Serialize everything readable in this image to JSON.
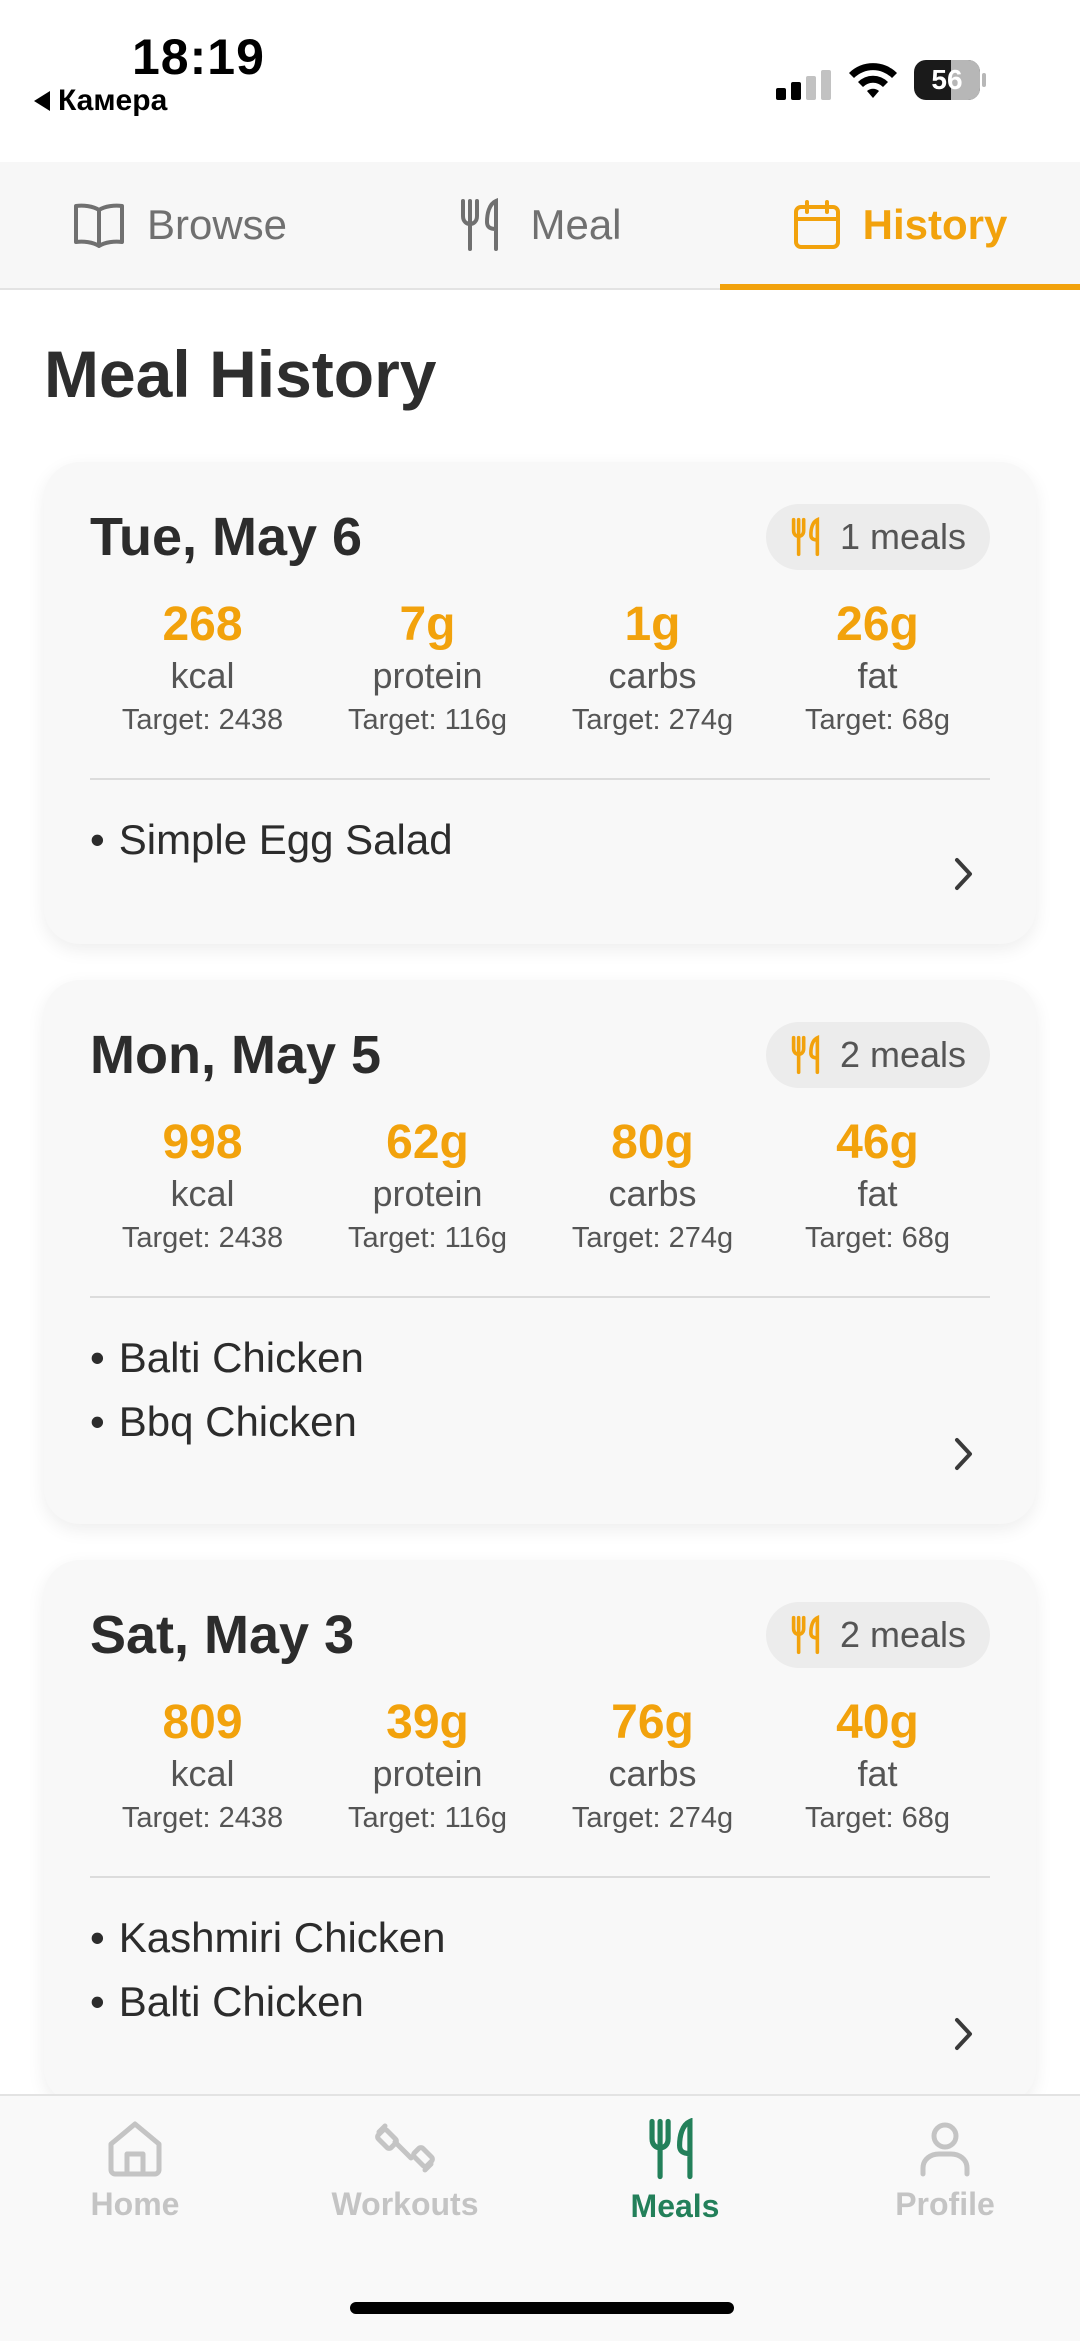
{
  "status_bar": {
    "time": "18:19",
    "back_label": "Камера",
    "battery": "56"
  },
  "top_tabs": [
    {
      "label": "Browse",
      "icon": "book-icon",
      "active": false
    },
    {
      "label": "Meal",
      "icon": "utensils-icon",
      "active": false
    },
    {
      "label": "History",
      "icon": "calendar-icon",
      "active": true
    }
  ],
  "page_title": "Meal History",
  "days": [
    {
      "date": "Tue, May 6",
      "meals_count": "1 meals",
      "macros": [
        {
          "value": "268",
          "unit": "kcal",
          "target": "Target: 2438"
        },
        {
          "value": "7g",
          "unit": "protein",
          "target": "Target: 116g"
        },
        {
          "value": "1g",
          "unit": "carbs",
          "target": "Target: 274g"
        },
        {
          "value": "26g",
          "unit": "fat",
          "target": "Target: 68g"
        }
      ],
      "meals": [
        "Simple Egg Salad"
      ]
    },
    {
      "date": "Mon, May 5",
      "meals_count": "2 meals",
      "macros": [
        {
          "value": "998",
          "unit": "kcal",
          "target": "Target: 2438"
        },
        {
          "value": "62g",
          "unit": "protein",
          "target": "Target: 116g"
        },
        {
          "value": "80g",
          "unit": "carbs",
          "target": "Target: 274g"
        },
        {
          "value": "46g",
          "unit": "fat",
          "target": "Target: 68g"
        }
      ],
      "meals": [
        "Balti Chicken",
        "Bbq Chicken"
      ]
    },
    {
      "date": "Sat, May 3",
      "meals_count": "2 meals",
      "macros": [
        {
          "value": "809",
          "unit": "kcal",
          "target": "Target: 2438"
        },
        {
          "value": "39g",
          "unit": "protein",
          "target": "Target: 116g"
        },
        {
          "value": "76g",
          "unit": "carbs",
          "target": "Target: 274g"
        },
        {
          "value": "40g",
          "unit": "fat",
          "target": "Target: 68g"
        }
      ],
      "meals": [
        "Kashmiri Chicken",
        "Balti Chicken"
      ]
    }
  ],
  "bottom_nav": [
    {
      "label": "Home",
      "icon": "home-icon",
      "active": false
    },
    {
      "label": "Workouts",
      "icon": "dumbbell-icon",
      "active": false
    },
    {
      "label": "Meals",
      "icon": "utensils-icon",
      "active": true
    },
    {
      "label": "Profile",
      "icon": "person-icon",
      "active": false
    }
  ],
  "colors": {
    "accent": "#f2a20c",
    "nav_active": "#23805a",
    "nav_inactive": "#c4c4c4",
    "card_bg": "#f8f8f8"
  }
}
